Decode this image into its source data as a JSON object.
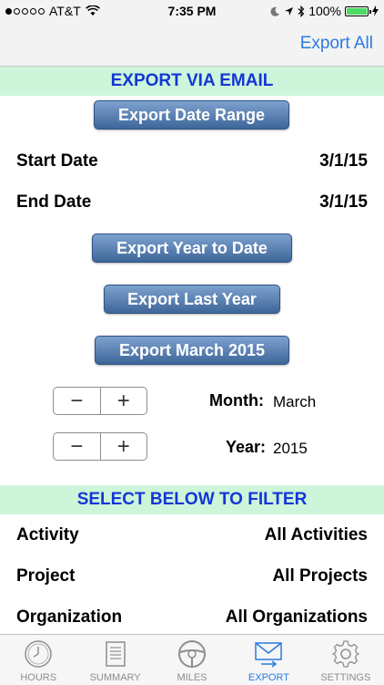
{
  "status_bar": {
    "carrier": "AT&T",
    "time": "7:35 PM",
    "battery": "100%"
  },
  "nav": {
    "export_all": "Export All"
  },
  "email_section": {
    "header": "EXPORT VIA EMAIL",
    "export_date_range": "Export Date Range",
    "start_date_label": "Start Date",
    "start_date_value": "3/1/15",
    "end_date_label": "End Date",
    "end_date_value": "3/1/15",
    "export_ytd": "Export Year to Date",
    "export_last_year": "Export Last Year",
    "export_month": "Export March 2015",
    "month_label": "Month:",
    "month_value": "March",
    "year_label": "Year:",
    "year_value": "2015"
  },
  "filter_section": {
    "header": "SELECT BELOW TO FILTER",
    "rows": [
      {
        "label": "Activity",
        "value": "All Activities"
      },
      {
        "label": "Project",
        "value": "All Projects"
      },
      {
        "label": "Organization",
        "value": "All Organizations"
      }
    ]
  },
  "tabs": [
    {
      "label": "HOURS",
      "icon": "clock-icon"
    },
    {
      "label": "SUMMARY",
      "icon": "document-icon"
    },
    {
      "label": "MILES",
      "icon": "steering-wheel-icon"
    },
    {
      "label": "EXPORT",
      "icon": "mail-icon",
      "active": true
    },
    {
      "label": "SETTINGS",
      "icon": "gear-icon"
    }
  ],
  "colors": {
    "accent": "#2a7ae2",
    "section_bg": "#ccf5d9",
    "section_text": "#1436d6",
    "button_top": "#7ea2cf",
    "button_bottom": "#3e6699"
  }
}
